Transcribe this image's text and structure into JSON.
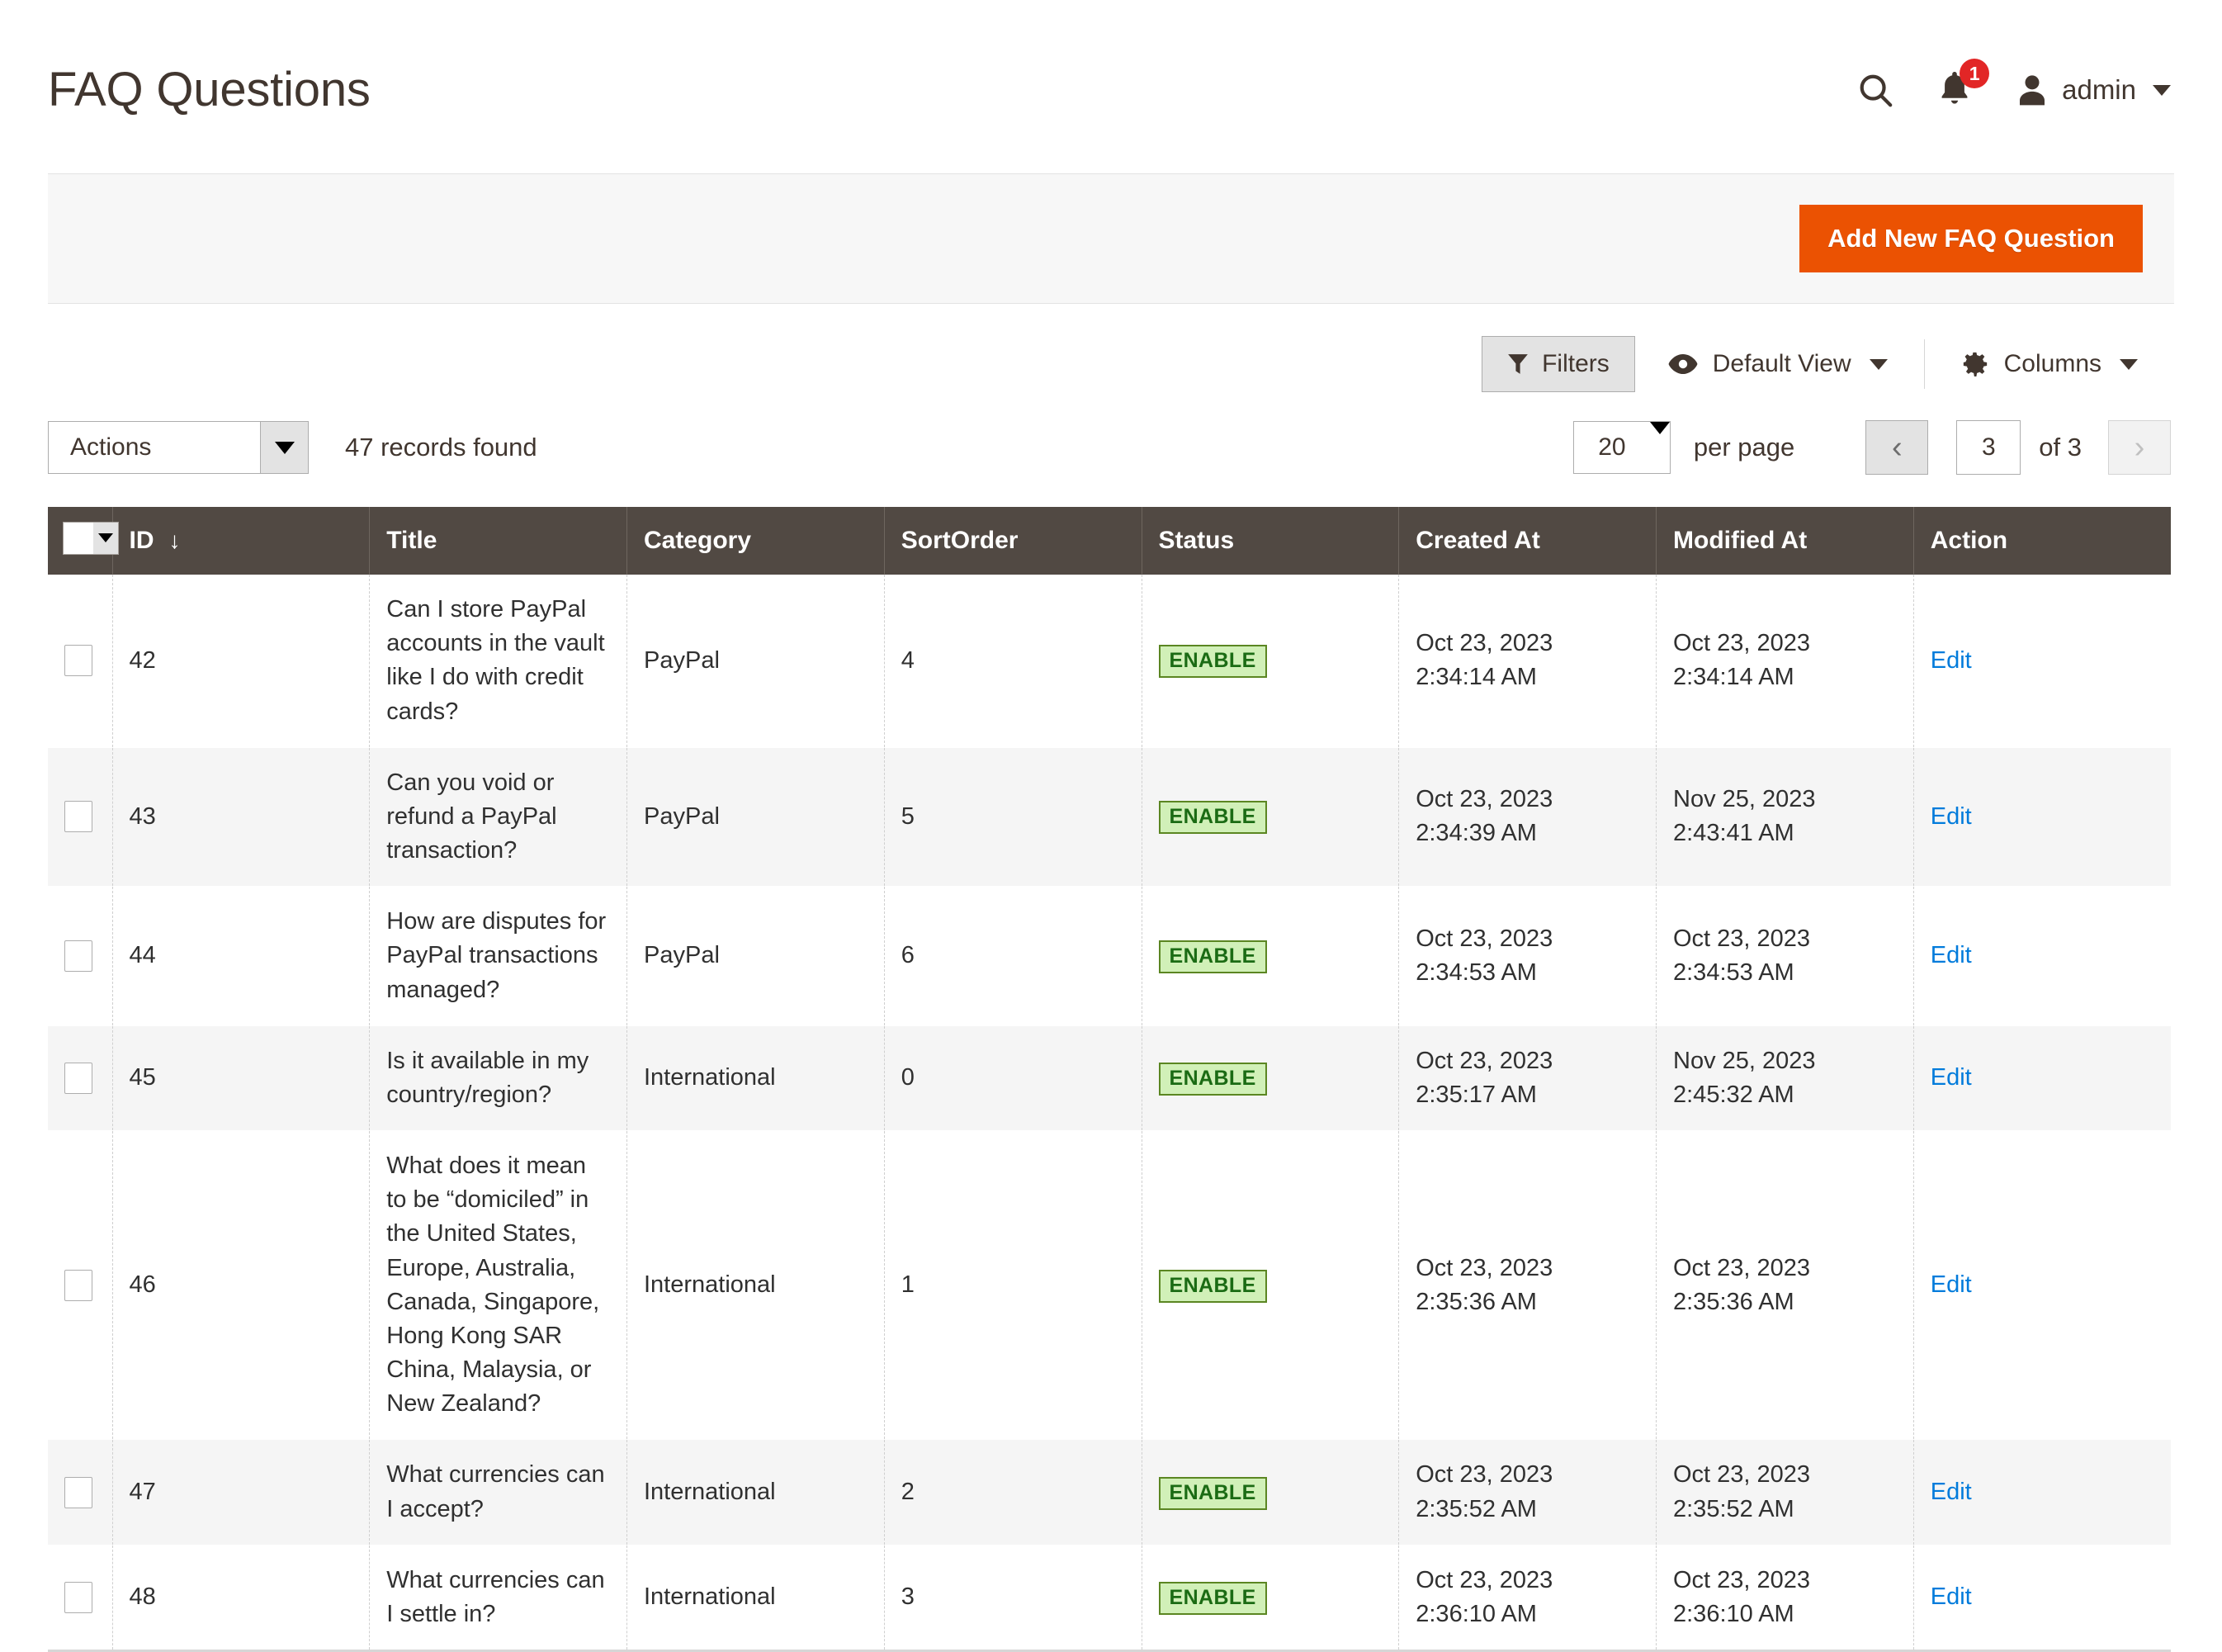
{
  "header": {
    "title": "FAQ Questions",
    "search_icon": "search-icon",
    "notification_icon": "bell-icon",
    "notification_count": "1",
    "avatar_icon": "user-icon",
    "admin_label": "admin"
  },
  "action_strip": {
    "add_button": "Add New FAQ Question"
  },
  "grid_tools": {
    "filters_label": "Filters",
    "filters_icon": "funnel-icon",
    "view_label": "Default View",
    "view_icon": "eye-icon",
    "columns_label": "Columns",
    "columns_icon": "gear-icon"
  },
  "grid_bar": {
    "actions_label": "Actions",
    "records_found": "47 records found",
    "per_page_value": "20",
    "per_page_label": "per page",
    "prev_glyph": "‹",
    "next_glyph": "›",
    "current_page": "3",
    "of_pages": "of 3"
  },
  "table": {
    "columns": [
      {
        "key": "check",
        "label": ""
      },
      {
        "key": "id",
        "label": "ID",
        "sort": "↓"
      },
      {
        "key": "title",
        "label": "Title"
      },
      {
        "key": "category",
        "label": "Category"
      },
      {
        "key": "sortorder",
        "label": "SortOrder"
      },
      {
        "key": "status",
        "label": "Status"
      },
      {
        "key": "created",
        "label": "Created At"
      },
      {
        "key": "modified",
        "label": "Modified At"
      },
      {
        "key": "action",
        "label": "Action"
      }
    ],
    "rows": [
      {
        "id": "42",
        "title": "Can I store PayPal accounts in the vault like I do with credit cards?",
        "category": "PayPal",
        "sortorder": "4",
        "status": "ENABLE",
        "created_date": "Oct 23, 2023",
        "created_time": "2:34:14 AM",
        "modified_date": "Oct 23, 2023",
        "modified_time": "2:34:14 AM",
        "action": "Edit"
      },
      {
        "id": "43",
        "title": "Can you void or refund a PayPal transaction?",
        "category": "PayPal",
        "sortorder": "5",
        "status": "ENABLE",
        "created_date": "Oct 23, 2023",
        "created_time": "2:34:39 AM",
        "modified_date": "Nov 25, 2023",
        "modified_time": "2:43:41 AM",
        "action": "Edit"
      },
      {
        "id": "44",
        "title": "How are disputes for PayPal transactions managed?",
        "category": "PayPal",
        "sortorder": "6",
        "status": "ENABLE",
        "created_date": "Oct 23, 2023",
        "created_time": "2:34:53 AM",
        "modified_date": "Oct 23, 2023",
        "modified_time": "2:34:53 AM",
        "action": "Edit"
      },
      {
        "id": "45",
        "title": "Is it available in my country/region?",
        "category": "International",
        "sortorder": "0",
        "status": "ENABLE",
        "created_date": "Oct 23, 2023",
        "created_time": "2:35:17 AM",
        "modified_date": "Nov 25, 2023",
        "modified_time": "2:45:32 AM",
        "action": "Edit"
      },
      {
        "id": "46",
        "title": "What does it mean to be “domiciled” in the United States, Europe, Australia, Canada, Singapore, Hong Kong SAR China, Malaysia, or New Zealand?",
        "category": "International",
        "sortorder": "1",
        "status": "ENABLE",
        "created_date": "Oct 23, 2023",
        "created_time": "2:35:36 AM",
        "modified_date": "Oct 23, 2023",
        "modified_time": "2:35:36 AM",
        "action": "Edit"
      },
      {
        "id": "47",
        "title": "What currencies can I accept?",
        "category": "International",
        "sortorder": "2",
        "status": "ENABLE",
        "created_date": "Oct 23, 2023",
        "created_time": "2:35:52 AM",
        "modified_date": "Oct 23, 2023",
        "modified_time": "2:35:52 AM",
        "action": "Edit"
      },
      {
        "id": "48",
        "title": "What currencies can I settle in?",
        "category": "International",
        "sortorder": "3",
        "status": "ENABLE",
        "created_date": "Oct 23, 2023",
        "created_time": "2:36:10 AM",
        "modified_date": "Oct 23, 2023",
        "modified_time": "2:36:10 AM",
        "action": "Edit"
      }
    ]
  },
  "colors": {
    "accent_orange": "#eb5202",
    "header_brown": "#514943",
    "link_blue": "#007bdb",
    "badge_green_bg": "#d1f0b8",
    "badge_green_text": "#1b6b14",
    "notification_red": "#e22626"
  }
}
